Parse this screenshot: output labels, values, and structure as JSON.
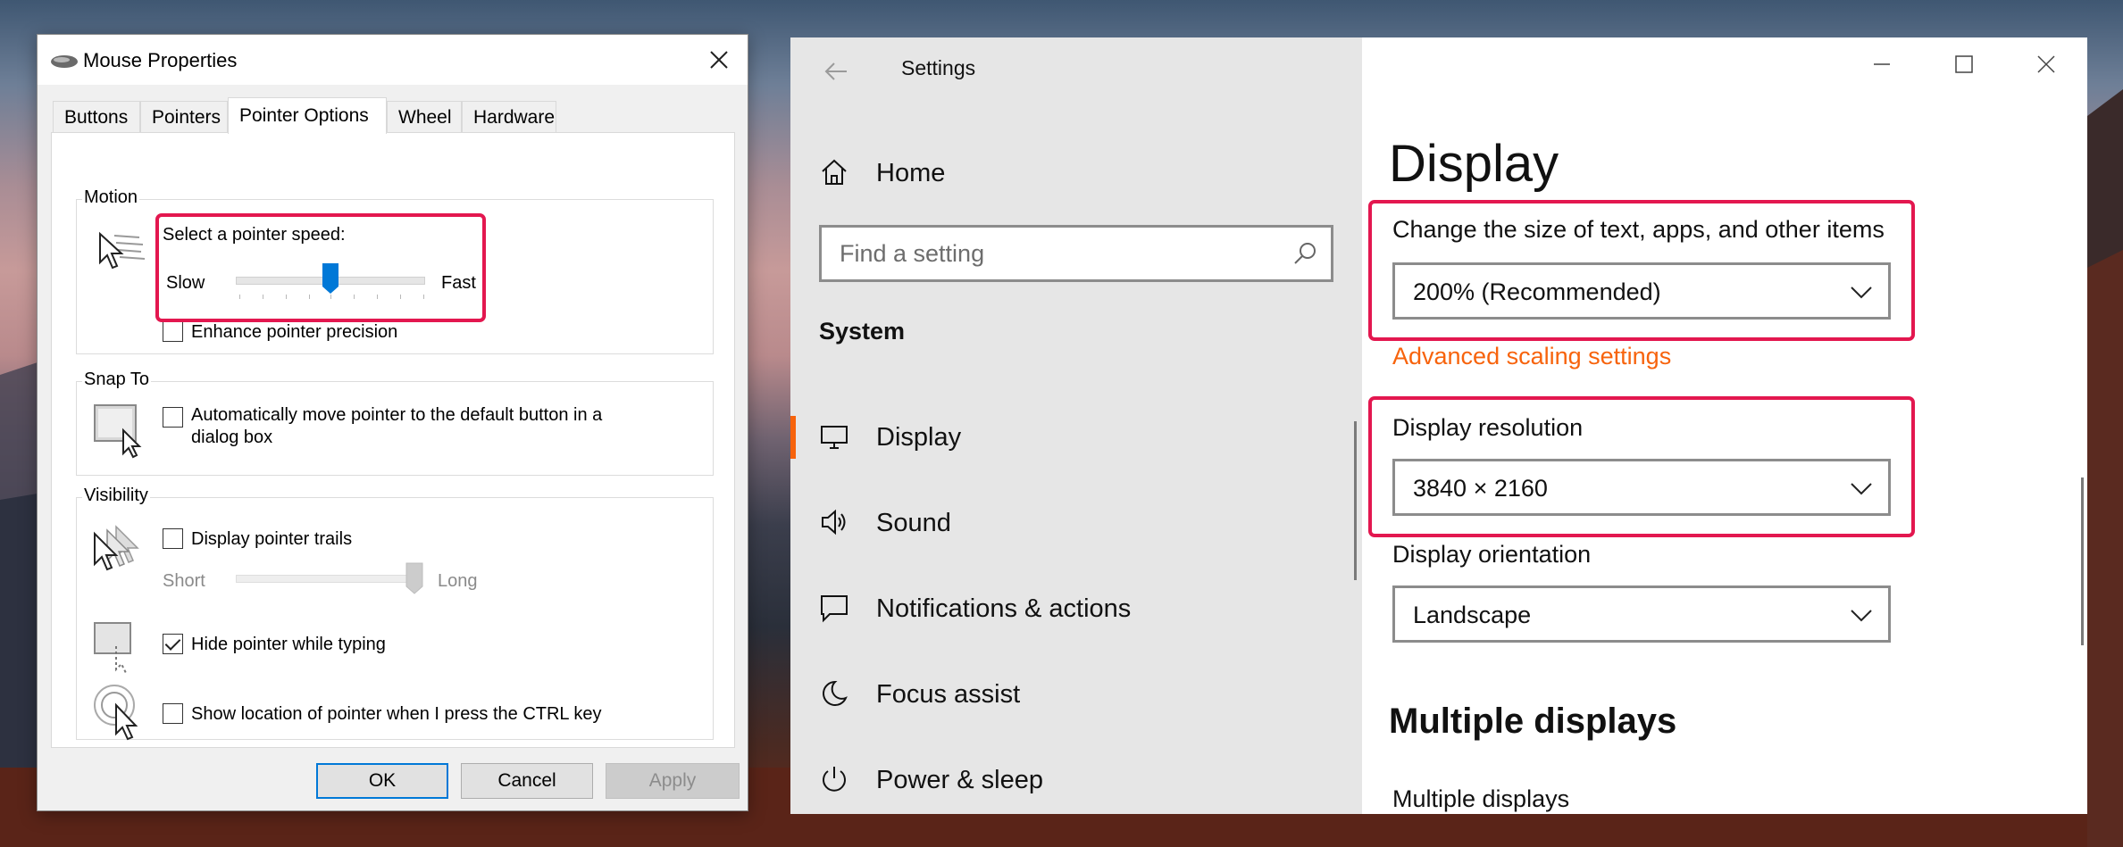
{
  "mouse_properties": {
    "title": "Mouse Properties",
    "tabs": [
      "Buttons",
      "Pointers",
      "Pointer Options",
      "Wheel",
      "Hardware"
    ],
    "active_tab": "Pointer Options",
    "motion": {
      "group_label": "Motion",
      "speed_label": "Select a pointer speed:",
      "slow_label": "Slow",
      "fast_label": "Fast",
      "speed_value": 0.5,
      "precision_label": "Enhance pointer precision",
      "precision_checked": false
    },
    "snap_to": {
      "group_label": "Snap To",
      "auto_move_label_line1": "Automatically move pointer to the default button in a",
      "auto_move_label_line2": "dialog box",
      "auto_move_checked": false
    },
    "visibility": {
      "group_label": "Visibility",
      "trails_label": "Display pointer trails",
      "trails_checked": false,
      "short_label": "Short",
      "long_label": "Long",
      "trails_length_value": 1.0,
      "hide_typing_label": "Hide pointer while typing",
      "hide_typing_checked": true,
      "show_location_label": "Show location of pointer when I press the CTRL key",
      "show_location_checked": false
    },
    "buttons": {
      "ok": "OK",
      "cancel": "Cancel",
      "apply": "Apply"
    }
  },
  "settings": {
    "app_title": "Settings",
    "home_label": "Home",
    "search_placeholder": "Find a setting",
    "section_label": "System",
    "nav_items": [
      {
        "label": "Display",
        "icon": "monitor-icon",
        "active": true
      },
      {
        "label": "Sound",
        "icon": "speaker-icon",
        "active": false
      },
      {
        "label": "Notifications & actions",
        "icon": "notification-icon",
        "active": false
      },
      {
        "label": "Focus assist",
        "icon": "moon-icon",
        "active": false
      },
      {
        "label": "Power & sleep",
        "icon": "power-icon",
        "active": false
      }
    ],
    "page_title": "Display",
    "scale_label": "Change the size of text, apps, and other items",
    "scale_value": "200% (Recommended)",
    "advanced_scaling_link": "Advanced scaling settings",
    "resolution_label": "Display resolution",
    "resolution_value": "3840 × 2160",
    "orientation_label": "Display orientation",
    "orientation_value": "Landscape",
    "multiple_displays_heading": "Multiple displays",
    "multiple_displays_label": "Multiple displays"
  },
  "colors": {
    "highlight": "#e3174f",
    "accent_orange": "#f7630c",
    "windows_blue": "#0078d7"
  }
}
